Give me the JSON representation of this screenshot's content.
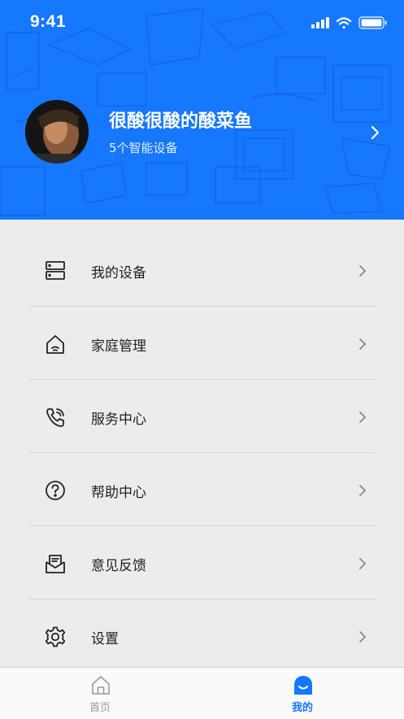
{
  "status_bar": {
    "time": "9:41"
  },
  "profile": {
    "username": "很酸很酸的酸菜鱼",
    "device_count": "5个智能设备"
  },
  "menu": [
    {
      "label": "我的设备",
      "icon": "devices-icon"
    },
    {
      "label": "家庭管理",
      "icon": "home-icon"
    },
    {
      "label": "服务中心",
      "icon": "phone-service-icon"
    },
    {
      "label": "帮助中心",
      "icon": "help-icon"
    },
    {
      "label": "意见反馈",
      "icon": "feedback-mail-icon"
    },
    {
      "label": "设置",
      "icon": "gear-icon"
    }
  ],
  "tabbar": {
    "tabs": [
      {
        "label": "首页",
        "icon": "home-tab-icon",
        "active": false
      },
      {
        "label": "我的",
        "icon": "profile-tab-icon",
        "active": true
      }
    ]
  },
  "colors": {
    "header": "#1677ff",
    "active_tab": "#1677ff",
    "inactive_tab": "#9a9a9a"
  }
}
